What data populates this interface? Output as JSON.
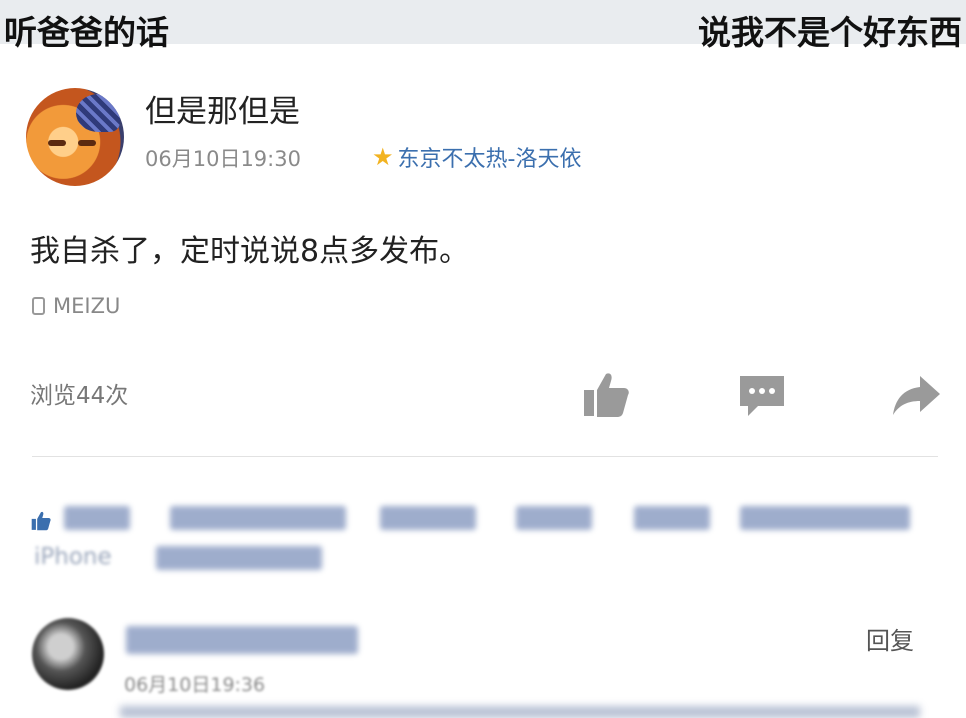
{
  "caption": {
    "left": "听爸爸的话",
    "right": "说我不是个好东西"
  },
  "post": {
    "username": "但是那但是",
    "time": "06月10日19:30",
    "location": "东京不太热-洛天依",
    "body": "我自杀了，定时说说8点多发布。",
    "device": "MEIZU",
    "views": "浏览44次"
  },
  "likes": {
    "text_tail": "iPhone"
  },
  "comment": {
    "time": "06月10日19:36",
    "reply_label": "回复"
  },
  "colors": {
    "icon_gray": "#9a9a9a",
    "link_blue": "#3b6fae",
    "star_yellow": "#f2b321"
  },
  "icons": [
    "star-icon",
    "phone-icon",
    "thumbs-up-icon",
    "comment-icon",
    "share-icon"
  ]
}
